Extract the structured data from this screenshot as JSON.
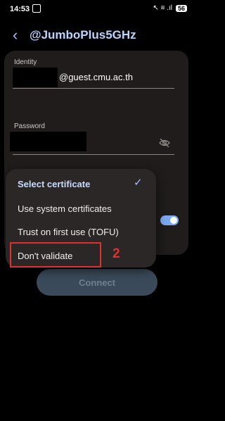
{
  "status_bar": {
    "time": "14:53",
    "battery": "56",
    "signal": "↖ ≡ .ıl"
  },
  "header": {
    "title": "@JumboPlus5GHz"
  },
  "identity": {
    "label": "Identity",
    "value_suffix": "@guest.cmu.ac.th"
  },
  "password": {
    "label": "Password"
  },
  "menu": {
    "items": [
      "Select certificate",
      "Use system certificates",
      "Trust on first use (TOFU)",
      "Don't validate"
    ],
    "selected_index": 0
  },
  "annotation": {
    "step_number": "2"
  },
  "connect": {
    "label": "Connect"
  },
  "colors": {
    "accent": "#9ec2ff",
    "highlight": "#e03131"
  }
}
